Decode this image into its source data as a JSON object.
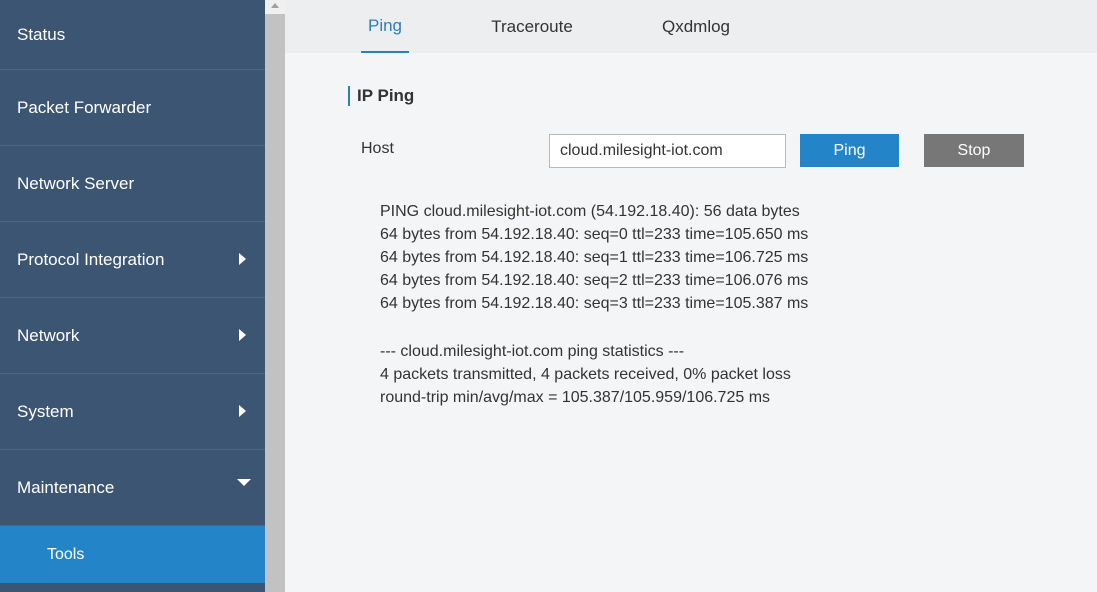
{
  "sidebar": {
    "items": [
      {
        "label": "Status"
      },
      {
        "label": "Packet Forwarder"
      },
      {
        "label": "Network Server"
      },
      {
        "label": "Protocol Integration"
      },
      {
        "label": "Network"
      },
      {
        "label": "System"
      },
      {
        "label": "Maintenance"
      }
    ],
    "sub_items": [
      {
        "label": "Tools"
      }
    ]
  },
  "tabs": [
    {
      "label": "Ping"
    },
    {
      "label": "Traceroute"
    },
    {
      "label": "Qxdmlog"
    }
  ],
  "main": {
    "section_title": "IP Ping",
    "host_label": "Host",
    "host_value": "cloud.milesight-iot.com",
    "ping_label": "Ping",
    "stop_label": "Stop",
    "output": {
      "lines": [
        "PING cloud.milesight-iot.com (54.192.18.40): 56 data bytes",
        "64 bytes from 54.192.18.40: seq=0 ttl=233 time=105.650 ms",
        "64 bytes from 54.192.18.40: seq=1 ttl=233 time=106.725 ms",
        "64 bytes from 54.192.18.40: seq=2 ttl=233 time=106.076 ms",
        "64 bytes from 54.192.18.40: seq=3 ttl=233 time=105.387 ms"
      ],
      "stats": [
        "--- cloud.milesight-iot.com ping statistics ---",
        "4 packets transmitted, 4 packets received, 0% packet loss",
        "round-trip min/avg/max = 105.387/105.959/106.725 ms"
      ]
    }
  },
  "colors": {
    "sidebar_bg": "#3c5573",
    "accent": "#2385c8",
    "stop_button": "#777777"
  }
}
